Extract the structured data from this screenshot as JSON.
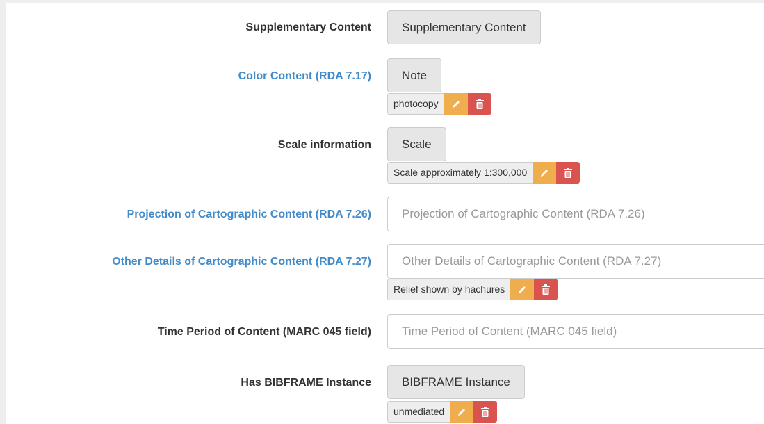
{
  "rows": [
    {
      "label": "Supplementary Content",
      "button": "Supplementary Content"
    },
    {
      "label": "Color Content (RDA 7.17)",
      "button": "Note",
      "tag": "photocopy"
    },
    {
      "label": "Scale information",
      "button": "Scale",
      "tag": "Scale approximately 1:300,000"
    },
    {
      "label": "Projection of Cartographic Content (RDA 7.26)",
      "placeholder": "Projection of Cartographic Content (RDA 7.26)"
    },
    {
      "label": "Other Details of Cartographic Content (RDA 7.27)",
      "placeholder": "Other Details of Cartographic Content (RDA 7.27)",
      "tag": "Relief shown by hachures"
    },
    {
      "label": "Time Period of Content (MARC 045 field)",
      "placeholder": "Time Period of Content (MARC 045 field)"
    },
    {
      "label": "Has BIBFRAME Instance",
      "button": "BIBFRAME Instance",
      "tag": "unmediated"
    }
  ],
  "colors": {
    "link_label": "#428bca",
    "edit_button": "#f0ad4e",
    "delete_button": "#d9534f"
  },
  "icons": {
    "edit": "pencil-icon",
    "delete": "trash-icon"
  }
}
